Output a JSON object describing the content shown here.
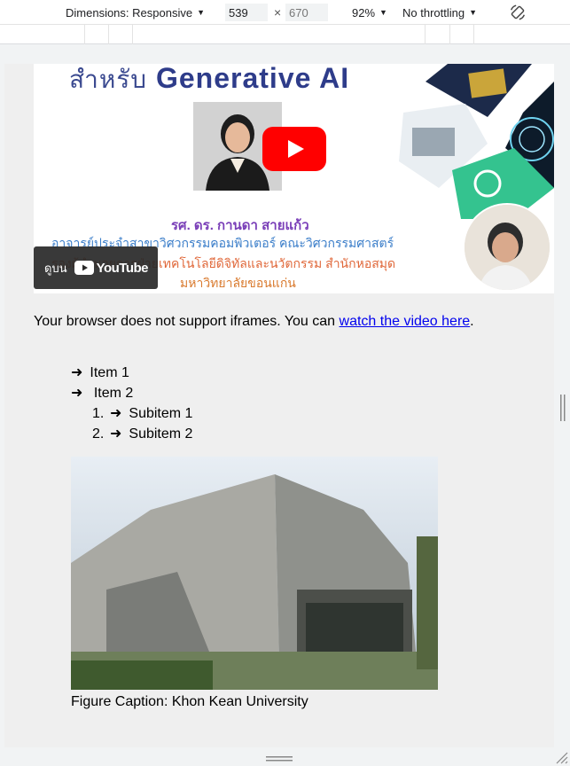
{
  "toolbar": {
    "dimensions_label": "Dimensions: Responsive",
    "width_value": "539",
    "height_value": "670",
    "times_sign": "×",
    "zoom_label": "92%",
    "throttle_label": "No throttling"
  },
  "video": {
    "title_prefix": "สำหรับ",
    "title_main": "Generative AI",
    "speaker_name": "รศ. ดร. กานดา สายแก้ว",
    "speaker_line1": "อาจารย์ประจำสาขาวิศวกรรมคอมพิวเตอร์ คณะวิศวกรรมศาสตร์",
    "speaker_line2": "รองผู้อำนวยการฝ่ายเทคโนโลยีดิจิทัลและนวัตกรรม สำนักหอสมุด",
    "speaker_line3": "มหาวิทยาลัยขอนแก่น",
    "watch_on": "ดูบน",
    "youtube_label": "YouTube",
    "colors": {
      "title": "#2e3c8a",
      "youtube_red": "#ff0000"
    }
  },
  "content": {
    "iframe_text": "Your browser does not support iframes. You can ",
    "iframe_link": "watch the video here",
    "iframe_end": ".",
    "list": [
      {
        "label": "Item 1"
      },
      {
        "label": "Item 2"
      }
    ],
    "sublist": [
      {
        "num": "1.",
        "label": "Subitem 1"
      },
      {
        "num": "2.",
        "label": "Subitem 2"
      }
    ],
    "arrow": "➜",
    "caption": "Figure Caption: Khon Kean University"
  }
}
